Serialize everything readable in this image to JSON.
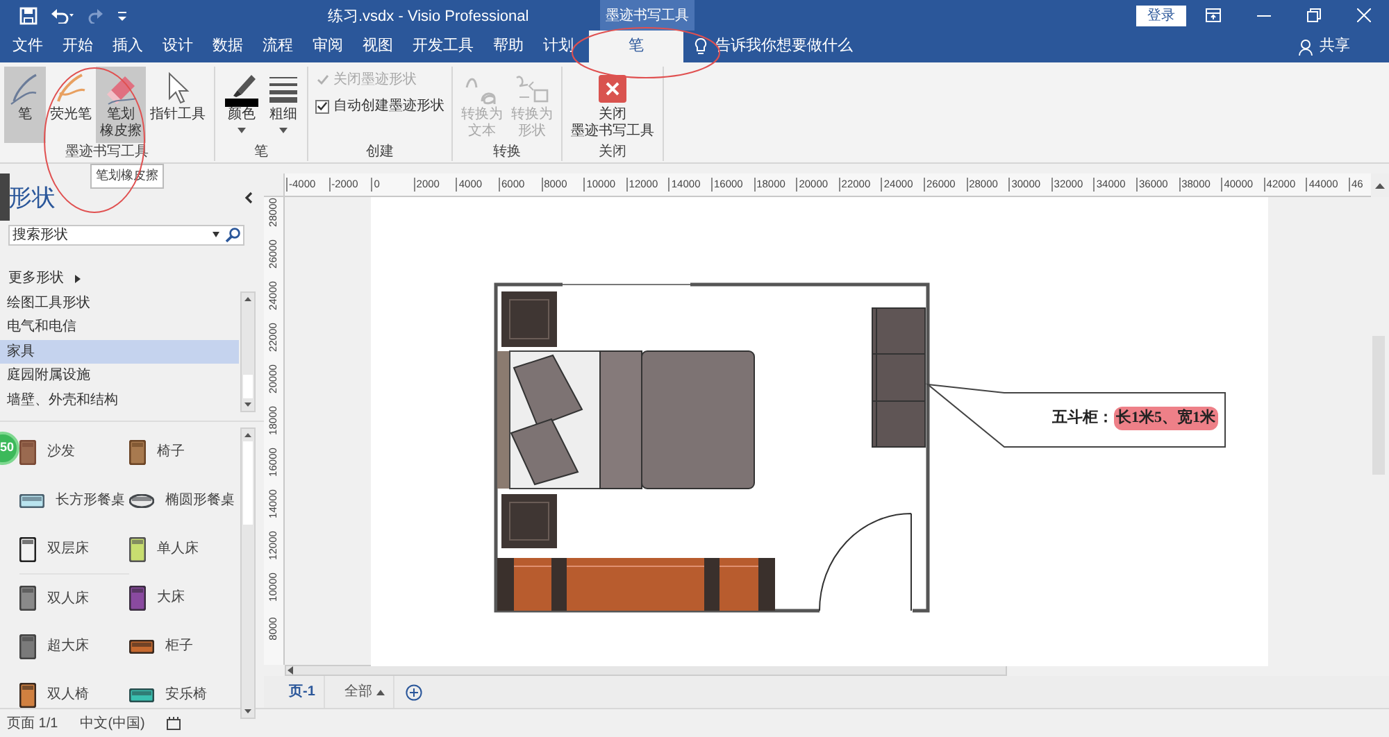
{
  "title_bar": {
    "document_title": "练习.vsdx  -  Visio Professional",
    "contextual_group": "墨迹书写工具",
    "sign_in": "登录"
  },
  "tabs": [
    {
      "label": "文件",
      "selected": false
    },
    {
      "label": "开始",
      "selected": false
    },
    {
      "label": "插入",
      "selected": false
    },
    {
      "label": "设计",
      "selected": false
    },
    {
      "label": "数据",
      "selected": false
    },
    {
      "label": "流程",
      "selected": false
    },
    {
      "label": "审阅",
      "selected": false
    },
    {
      "label": "视图",
      "selected": false
    },
    {
      "label": "开发工具",
      "selected": false
    },
    {
      "label": "帮助",
      "selected": false
    },
    {
      "label": "计划",
      "selected": false
    },
    {
      "label": "笔",
      "selected": true
    }
  ],
  "tell_me": "告诉我你想要做什么",
  "share": "共享",
  "ribbon": {
    "groups": [
      {
        "label": "墨迹书写工具",
        "items": [
          {
            "kind": "pen",
            "label": [
              "笔"
            ],
            "selected": true
          },
          {
            "kind": "highlighter",
            "label": [
              "荧光笔"
            ],
            "selected": false
          },
          {
            "kind": "eraser",
            "label": [
              "笔划",
              "橡皮擦"
            ],
            "selected": true
          },
          {
            "kind": "pointer",
            "label": [
              "指针工具"
            ],
            "selected": false
          }
        ]
      },
      {
        "label": "笔",
        "items": [
          {
            "kind": "color",
            "label": [
              "颜色"
            ]
          },
          {
            "kind": "weight",
            "label": [
              "粗细"
            ]
          }
        ]
      },
      {
        "label": "创建",
        "items": [
          {
            "kind": "checkbox",
            "label": [
              "关闭墨迹形状"
            ],
            "checked": true,
            "disabled": true
          },
          {
            "kind": "checkbox",
            "label": [
              "自动创建墨迹形状"
            ],
            "checked": true,
            "disabled": false
          }
        ]
      },
      {
        "label": "转换",
        "items": [
          {
            "kind": "convert-text",
            "label": [
              "转换为",
              "文本"
            ],
            "disabled": true
          },
          {
            "kind": "convert-shape",
            "label": [
              "转换为",
              "形状"
            ],
            "disabled": true
          }
        ]
      },
      {
        "label": "关闭",
        "items": [
          {
            "kind": "close",
            "label": [
              "关闭",
              "墨迹书写工具"
            ]
          }
        ]
      }
    ]
  },
  "tooltip": "笔划橡皮擦",
  "shapes_panel": {
    "title": "形状",
    "search": {
      "placeholder": "搜索形状"
    },
    "more_shapes": "更多形状",
    "badge": "50",
    "stencils": [
      {
        "label": "绘图工具形状",
        "selected": false
      },
      {
        "label": "电气和电信",
        "selected": false
      },
      {
        "label": "家具",
        "selected": true
      },
      {
        "label": "庭园附属设施",
        "selected": false
      },
      {
        "label": "墙壁、外壳和结构",
        "selected": false
      }
    ],
    "shapes": [
      {
        "kind": "sofa",
        "label": "沙发"
      },
      {
        "kind": "chair",
        "label": "椅子"
      },
      {
        "kind": "rect-table",
        "label": "长方形餐桌"
      },
      {
        "kind": "oval-table",
        "label": "椭圆形餐桌"
      },
      {
        "kind": "bunk-bed",
        "label": "双层床"
      },
      {
        "kind": "single-bed",
        "label": "单人床"
      },
      {
        "kind": "double-bed",
        "label": "双人床"
      },
      {
        "kind": "queen-bed",
        "label": "大床"
      },
      {
        "kind": "king-bed",
        "label": "超大床"
      },
      {
        "kind": "cabinet",
        "label": "柜子"
      },
      {
        "kind": "loveseat",
        "label": "双人椅"
      },
      {
        "kind": "recliner",
        "label": "安乐椅"
      }
    ]
  },
  "rulers": {
    "horizontal": [
      "-4000",
      "-2000",
      "0",
      "2000",
      "4000",
      "6000",
      "8000",
      "10000",
      "12000",
      "14000",
      "16000",
      "18000",
      "20000",
      "22000",
      "24000",
      "26000",
      "28000",
      "30000",
      "32000",
      "34000",
      "36000",
      "38000",
      "40000",
      "42000",
      "44000",
      "46"
    ],
    "vertical": [
      "28000",
      "26000",
      "24000",
      "22000",
      "20000",
      "18000",
      "16000",
      "14000",
      "12000",
      "10000",
      "8000"
    ]
  },
  "callout": {
    "label": "五斗柜：",
    "value": "长1米5、宽1米",
    "highlighted": true
  },
  "page_tabs": [
    {
      "label": "页-1",
      "selected": true
    },
    {
      "label": "全部",
      "selected": false
    }
  ],
  "status_bar": [
    "页面 1/1",
    "中文(中国)"
  ]
}
